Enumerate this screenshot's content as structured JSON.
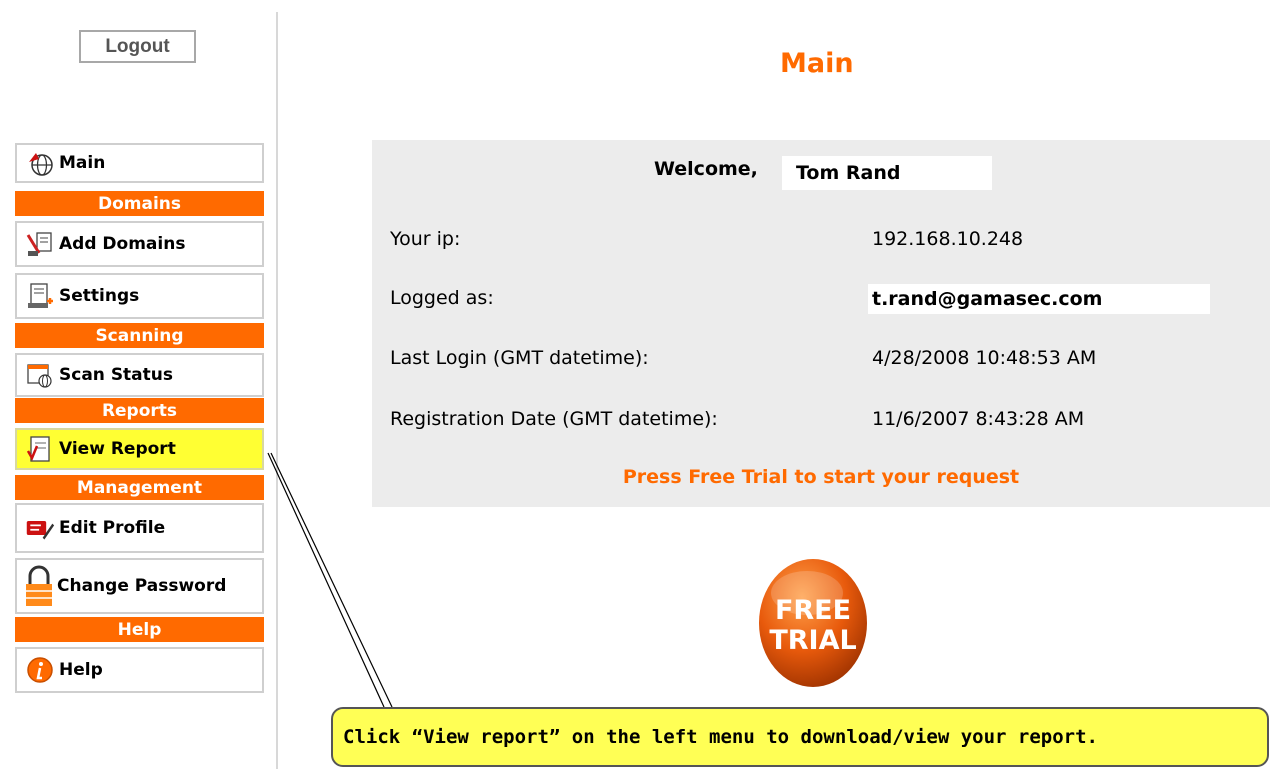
{
  "logout_label": "Logout",
  "page_title": "Main",
  "menu": {
    "main": "Main",
    "section_domains": "Domains",
    "add_domains": "Add Domains",
    "settings": "Settings",
    "section_scanning": "Scanning",
    "scan_status": "Scan Status",
    "section_reports": "Reports",
    "view_report": "View Report",
    "section_management": "Management",
    "edit_profile": "Edit Profile",
    "change_password": "Change Password",
    "section_help": "Help",
    "help": "Help"
  },
  "info": {
    "welcome_label": "Welcome,",
    "user_name": "Tom Rand",
    "ip_label": "Your ip:",
    "ip_value": "192.168.10.248",
    "logged_label": "Logged as:",
    "logged_value": "t.rand@gamasec.com",
    "last_login_label": "Last Login (GMT datetime):",
    "last_login_value": "4/28/2008 10:48:53 AM",
    "registration_label": "Registration Date (GMT datetime):",
    "registration_value": "11/6/2007 8:43:28 AM",
    "press_text": "Press Free Trial to start your request"
  },
  "free_trial": {
    "line1": "FREE",
    "line2": "TRIAL"
  },
  "callout_text": "Click “View report” on the left menu to download/view your report.",
  "colors": {
    "accent": "#ff6a00",
    "highlight": "#ffff33",
    "panel": "#ececec"
  },
  "icons": {
    "main": "globe-arrow-icon",
    "add_domains": "add-domain-icon",
    "settings": "settings-icon",
    "scan_status": "scan-status-icon",
    "view_report": "report-icon",
    "edit_profile": "edit-profile-icon",
    "change_password": "lock-icon",
    "help": "info-icon"
  }
}
